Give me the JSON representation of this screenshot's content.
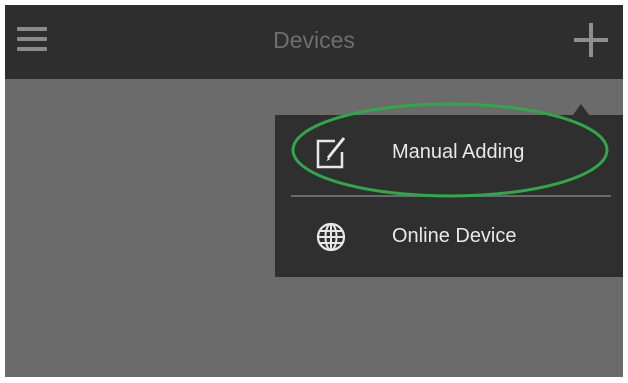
{
  "header": {
    "title": "Devices",
    "menu_icon": "hamburger-menu-icon",
    "add_icon": "plus-icon"
  },
  "dropdown": {
    "items": [
      {
        "label": "Manual Adding",
        "icon": "edit-icon",
        "highlighted": true
      },
      {
        "label": "Online Device",
        "icon": "globe-icon",
        "highlighted": false
      }
    ]
  },
  "colors": {
    "topbar": "#2e2e2e",
    "background": "#6b6b6b",
    "dropdown": "#2f2f2f",
    "highlight_ring": "#2ea84a"
  }
}
